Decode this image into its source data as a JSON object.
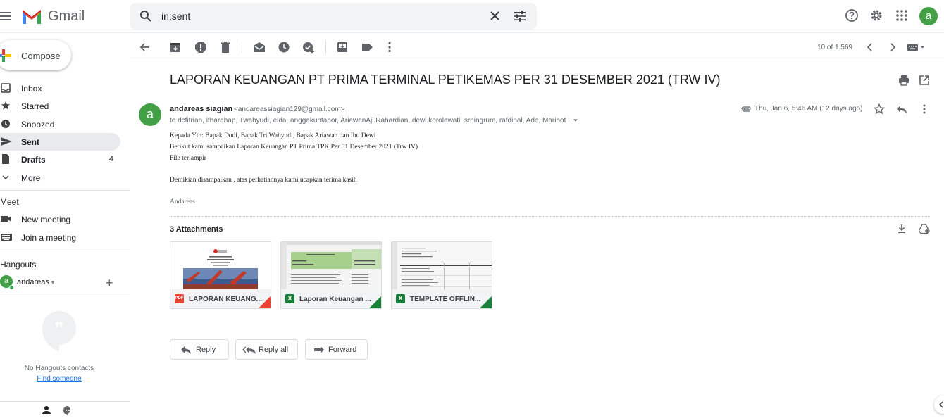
{
  "header": {
    "app_name": "Gmail",
    "search_value": "in:sent"
  },
  "colors": {
    "accent_green": "#43a047",
    "active_nav": "#e8eaed",
    "link_blue": "#1a73e8"
  },
  "icons": [
    "menu-icon",
    "gmail-logo",
    "search-icon",
    "close-icon",
    "tune-icon",
    "help-icon",
    "gear-icon",
    "apps-icon",
    "back-arrow-icon",
    "archive-icon",
    "report-spam-icon",
    "delete-icon",
    "mark-unread-icon",
    "snooze-icon",
    "add-task-icon",
    "move-to-icon",
    "label-icon",
    "more-vert-icon",
    "chevron-left-icon",
    "chevron-right-icon",
    "keyboard-icon",
    "print-icon",
    "open-new-window-icon",
    "star-icon",
    "reply-icon",
    "download-icon",
    "drive-add-icon"
  ],
  "account": {
    "avatar_letter": "a"
  },
  "sidebar": {
    "compose_label": "Compose",
    "items": [
      {
        "label": "Inbox",
        "count": ""
      },
      {
        "label": "Starred",
        "count": ""
      },
      {
        "label": "Snoozed",
        "count": ""
      },
      {
        "label": "Sent",
        "count": ""
      },
      {
        "label": "Drafts",
        "count": "4"
      },
      {
        "label": "More",
        "count": ""
      }
    ],
    "meet": {
      "title": "Meet",
      "items": [
        {
          "label": "New meeting"
        },
        {
          "label": "Join a meeting"
        }
      ]
    },
    "hangouts": {
      "title": "Hangouts",
      "user_letter": "a",
      "user_name": "andareas",
      "empty_text": "No Hangouts contacts",
      "find_link": "Find someone"
    }
  },
  "toolbar": {
    "pager": "10 of 1,569"
  },
  "message": {
    "subject": "LAPORAN KEUANGAN PT PRIMA TERMINAL PETIKEMAS PER 31 DESEMBER 2021 (TRW IV)",
    "sender_letter": "a",
    "sender_name": "andareas siagian",
    "sender_email": "<andareassiagian129@gmail.com>",
    "recipients": "to dcfitrian, ifharahap, Twahyudi, elda, anggakuntapor, AriawanAji.Rahardian, dewi.korolawati, srningrum, rafdinal, Ade, Marihot",
    "date": "Thu, Jan 6, 5:46 AM (12 days ago)",
    "body": [
      "Kepada Yth: Bapak Dodi, Bapak Tri Wahyudi, Bapak Ariawan dan Ibu Dewi",
      "Berikut kami sampaikan Laporan Keuangan PT Prima TPK Per 31 Desember 2021 (Trw IV)",
      "File terlampir",
      "Demikian disampaikan , atas perhatiannya kami ucapkan terima kasih"
    ],
    "signature": "Andareas",
    "attachments_title": "3 Attachments",
    "attachments": [
      {
        "name": "LAPORAN KEUANG...",
        "type": "PDF",
        "type_color": "#ea4335"
      },
      {
        "name": "Laporan Keuangan ...",
        "type": "X",
        "type_color": "#188038"
      },
      {
        "name": "TEMPLATE OFFLIN...",
        "type": "X",
        "type_color": "#188038"
      }
    ],
    "actions": {
      "reply": "Reply",
      "reply_all": "Reply all",
      "forward": "Forward"
    }
  }
}
